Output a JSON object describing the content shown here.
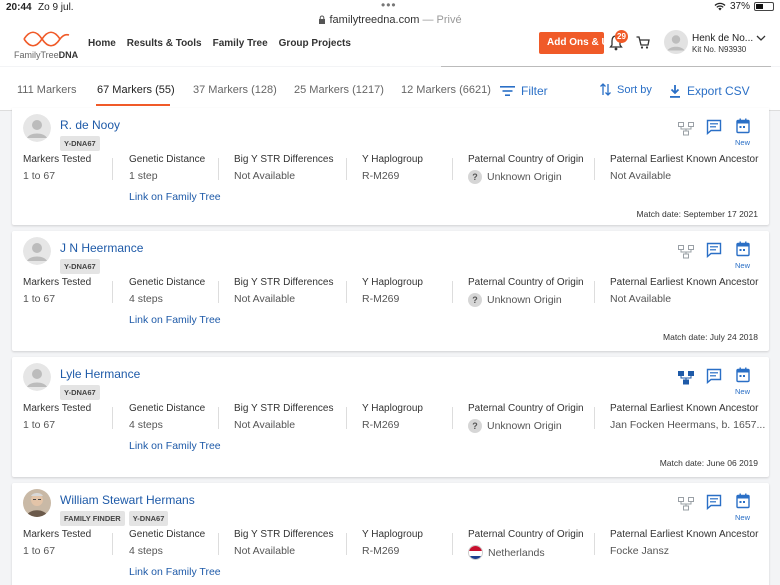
{
  "status_bar": {
    "time": "20:44",
    "date": "Zo 9 jul.",
    "battery": "37%"
  },
  "url_bar": {
    "domain": "familytreedna.com",
    "suffix": "— Privé"
  },
  "header": {
    "logo_text_1": "FamilyTree",
    "logo_text_2": "DNA",
    "nav": [
      "Home",
      "Results & Tools",
      "Family Tree",
      "Group Projects"
    ],
    "addons_label": "Add Ons & Upgrades",
    "notification_count": "29",
    "user_name": "Henk de No...",
    "kit_no": "Kit No. N93930"
  },
  "tabs": [
    {
      "label": "111 Markers",
      "active": false
    },
    {
      "label": "67 Markers (55)",
      "active": true
    },
    {
      "label": "37 Markers (128)",
      "active": false
    },
    {
      "label": "25 Markers (1217)",
      "active": false
    },
    {
      "label": "12 Markers (6621)",
      "active": false
    }
  ],
  "tools": {
    "filter": "Filter",
    "sort": "Sort by",
    "export": "Export CSV"
  },
  "labels": {
    "markers_tested": "Markers Tested",
    "genetic_distance": "Genetic Distance",
    "big_y": "Big Y STR Differences",
    "haplogroup": "Y Haplogroup",
    "country": "Paternal Country of Origin",
    "ancestor": "Paternal Earliest Known Ancestor",
    "link": "Link on Family Tree",
    "new": "New",
    "match_date_prefix": "Match date: "
  },
  "matches": [
    {
      "name": "R. de Nooy",
      "tags": [
        "Y-DNA67"
      ],
      "markers": "1 to 67",
      "distance": "1 step",
      "big_y": "Not Available",
      "haplogroup": "R-M269",
      "country": "Unknown Origin",
      "country_icon": "question-icon",
      "ancestor": "Not Available",
      "match_date": "September 17 2021",
      "tree_active": false
    },
    {
      "name": "J N Heermance",
      "tags": [
        "Y-DNA67"
      ],
      "markers": "1 to 67",
      "distance": "4 steps",
      "big_y": "Not Available",
      "haplogroup": "R-M269",
      "country": "Unknown Origin",
      "country_icon": "question-icon",
      "ancestor": "Not Available",
      "match_date": "July 24 2018",
      "tree_active": false
    },
    {
      "name": "Lyle Hermance",
      "tags": [
        "Y-DNA67"
      ],
      "markers": "1 to 67",
      "distance": "4 steps",
      "big_y": "Not Available",
      "haplogroup": "R-M269",
      "country": "Unknown Origin",
      "country_icon": "question-icon",
      "ancestor": "Jan Focken Heermans, b. 1657...",
      "match_date": "June 06 2019",
      "tree_active": true
    },
    {
      "name": "William Stewart Hermans",
      "tags": [
        "FAMILY FINDER",
        "Y-DNA67"
      ],
      "markers": "1 to 67",
      "distance": "4 steps",
      "big_y": "Not Available",
      "haplogroup": "R-M269",
      "country": "Netherlands",
      "country_icon": "netherlands-flag-icon",
      "ancestor": "Focke Jansz",
      "match_date": "",
      "tree_active": false
    }
  ],
  "colors": {
    "accent": "#f05a28",
    "link": "#1e5aa8",
    "icon_blue": "#2a6fc6"
  }
}
